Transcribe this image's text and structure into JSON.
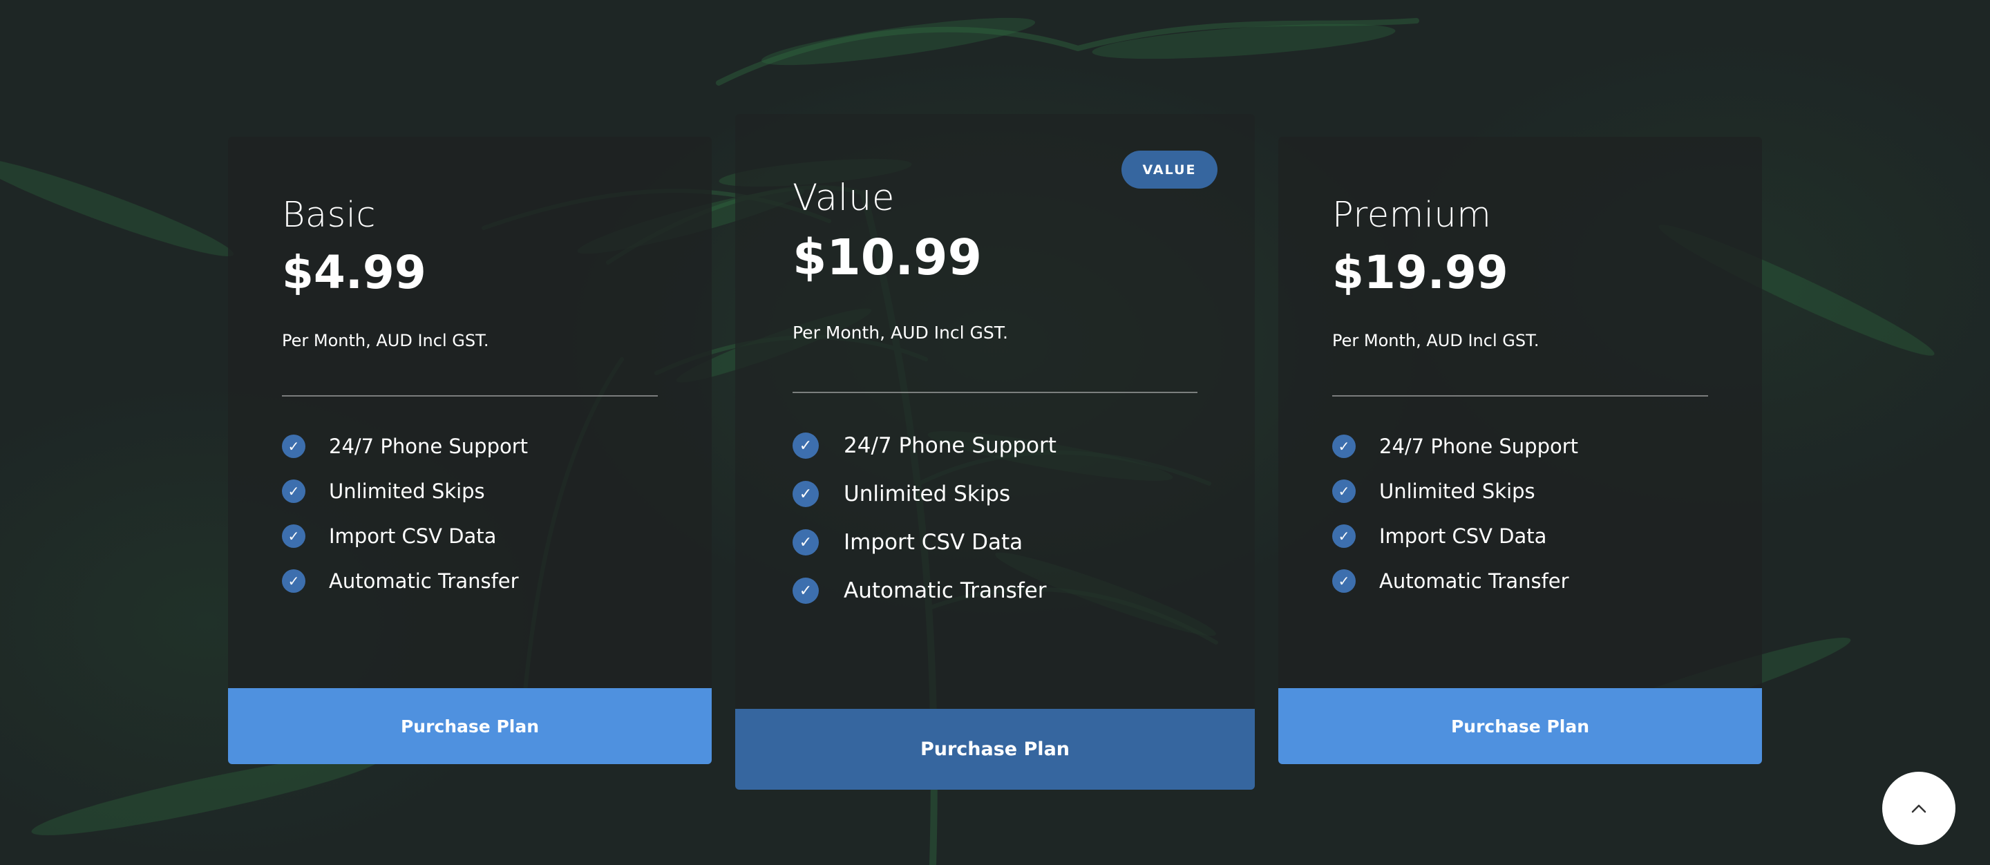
{
  "plans": [
    {
      "name": "Basic",
      "price": "$4.99",
      "note": "Per Month, AUD Incl GST.",
      "features": [
        "24/7 Phone Support",
        "Unlimited Skips",
        "Import CSV Data",
        "Automatic Transfer"
      ],
      "cta": "Purchase Plan"
    },
    {
      "name": "Value",
      "badge": "VALUE",
      "price": "$10.99",
      "note": "Per Month, AUD Incl GST.",
      "features": [
        "24/7 Phone Support",
        "Unlimited Skips",
        "Import CSV Data",
        "Automatic Transfer"
      ],
      "cta": "Purchase Plan"
    },
    {
      "name": "Premium",
      "price": "$19.99",
      "note": "Per Month, AUD Incl GST.",
      "features": [
        "24/7 Phone Support",
        "Unlimited Skips",
        "Import CSV Data",
        "Automatic Transfer"
      ],
      "cta": "Purchase Plan"
    }
  ],
  "icons": {
    "feature_check": "check-icon",
    "scroll_top": "chevron-up-icon"
  },
  "colors": {
    "background": "#1e2625",
    "card": "#1e2222",
    "cta_primary": "#4f91df",
    "cta_featured": "#36669f",
    "badge": "#36669f",
    "check": "#3d6fae"
  }
}
